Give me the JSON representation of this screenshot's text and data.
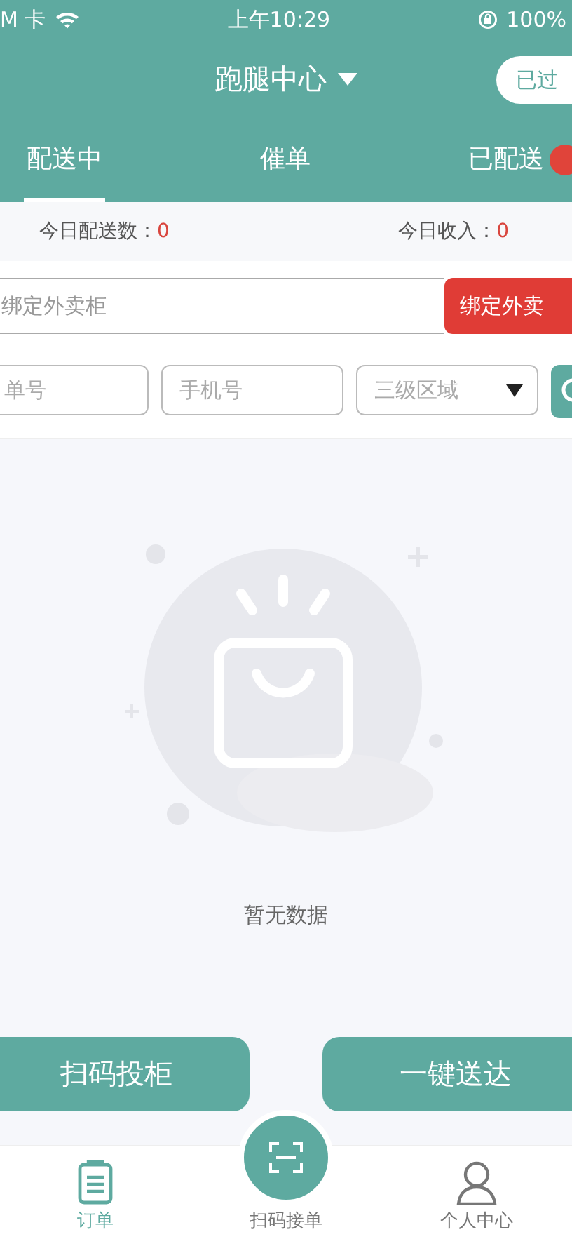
{
  "status_bar": {
    "carrier": "M 卡",
    "time": "上午10:29",
    "battery": "100%"
  },
  "header": {
    "title": "跑腿中心",
    "action": "已过"
  },
  "tabs": [
    {
      "label": "配送中",
      "selected": true,
      "badge": false
    },
    {
      "label": "催单",
      "selected": false,
      "badge": false
    },
    {
      "label": "已配送",
      "selected": false,
      "badge": true
    }
  ],
  "stats": [
    {
      "label": "今日配送数：",
      "value": "0"
    },
    {
      "label": "今日收入：",
      "value": "0"
    }
  ],
  "bind": {
    "placeholder": "绑定外卖柜",
    "button": "绑定外卖"
  },
  "filters": [
    {
      "kind": "input",
      "placeholder": "单号"
    },
    {
      "kind": "input",
      "placeholder": "手机号"
    },
    {
      "kind": "select",
      "placeholder": "三级区域"
    }
  ],
  "empty": {
    "message": "暂无数据"
  },
  "actions": [
    "扫码投柜",
    "一键送达"
  ],
  "nav": [
    {
      "kind": "tab",
      "label": "订单",
      "selected": true
    },
    {
      "kind": "center",
      "label": "扫码接单",
      "selected": false
    },
    {
      "kind": "tab",
      "label": "个人中心",
      "selected": false
    }
  ]
}
